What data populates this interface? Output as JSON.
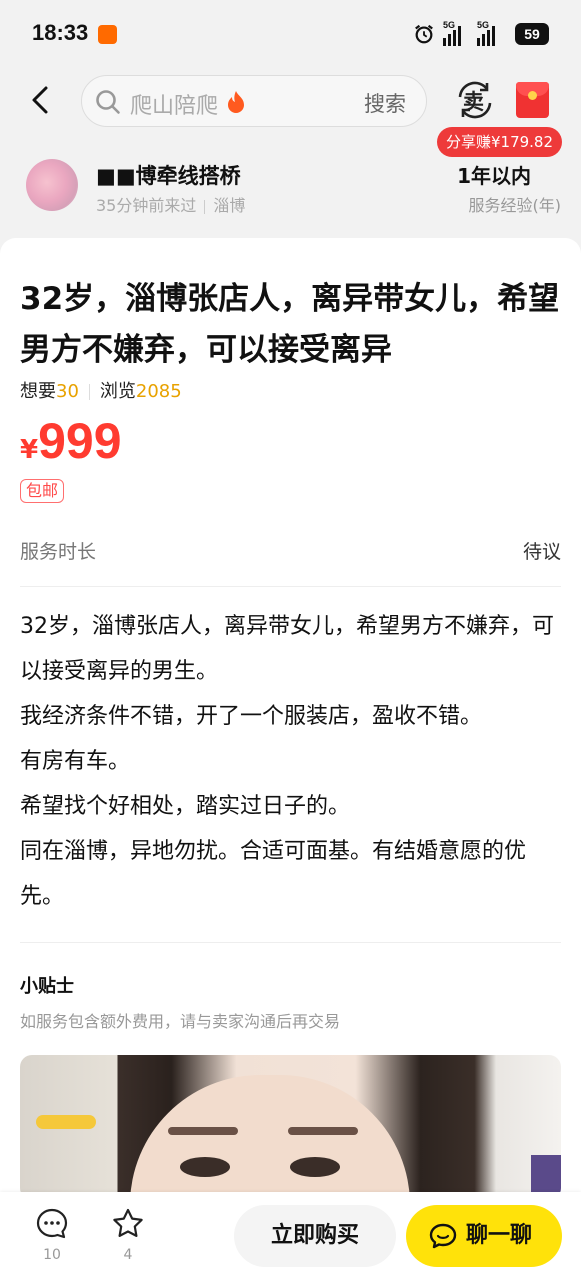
{
  "status_bar": {
    "time": "18:33",
    "app_badge": "淘宝闪购",
    "network1": "5G",
    "network2": "5G",
    "battery": "59"
  },
  "header": {
    "search_placeholder": "爬山陪爬",
    "search_button": "搜索",
    "sell_label": "卖",
    "share_earn": "分享赚¥179.82"
  },
  "seller": {
    "name": "■■博牵线搭桥",
    "last_seen": "35分钟前来过",
    "location": "淄博",
    "experience_value": "1年以内",
    "experience_label": "服务经验(年)"
  },
  "item": {
    "title": "32岁，淄博张店人，离异带女儿，希望男方不嫌弃，可以接受离异",
    "want_label": "想要",
    "want_count": "30",
    "view_label": "浏览",
    "view_count": "2085",
    "price_symbol": "¥",
    "price": "999",
    "shipping_tag": "包邮",
    "service_duration_label": "服务时长",
    "service_duration_value": "待议",
    "description": [
      "32岁，淄博张店人，离异带女儿，希望男方不嫌弃，可以接受离异的男生。",
      "我经济条件不错，开了一个服装店，盈收不错。",
      "有房有车。",
      "希望找个好相处，踏实过日子的。",
      "同在淄博，异地勿扰。合适可面基。有结婚意愿的优先。"
    ],
    "tips_title": "小贴士",
    "tips_text": "如服务包含额外费用，请与卖家沟通后再交易"
  },
  "bottom_bar": {
    "comment_count": "10",
    "favorite_count": "4",
    "buy_label": "立即购买",
    "chat_label": "聊一聊"
  },
  "colors": {
    "price": "#ff3b30",
    "accent_yellow": "#ffe20a",
    "count_orange": "#e8a200",
    "share_red": "#ee3a3a"
  }
}
